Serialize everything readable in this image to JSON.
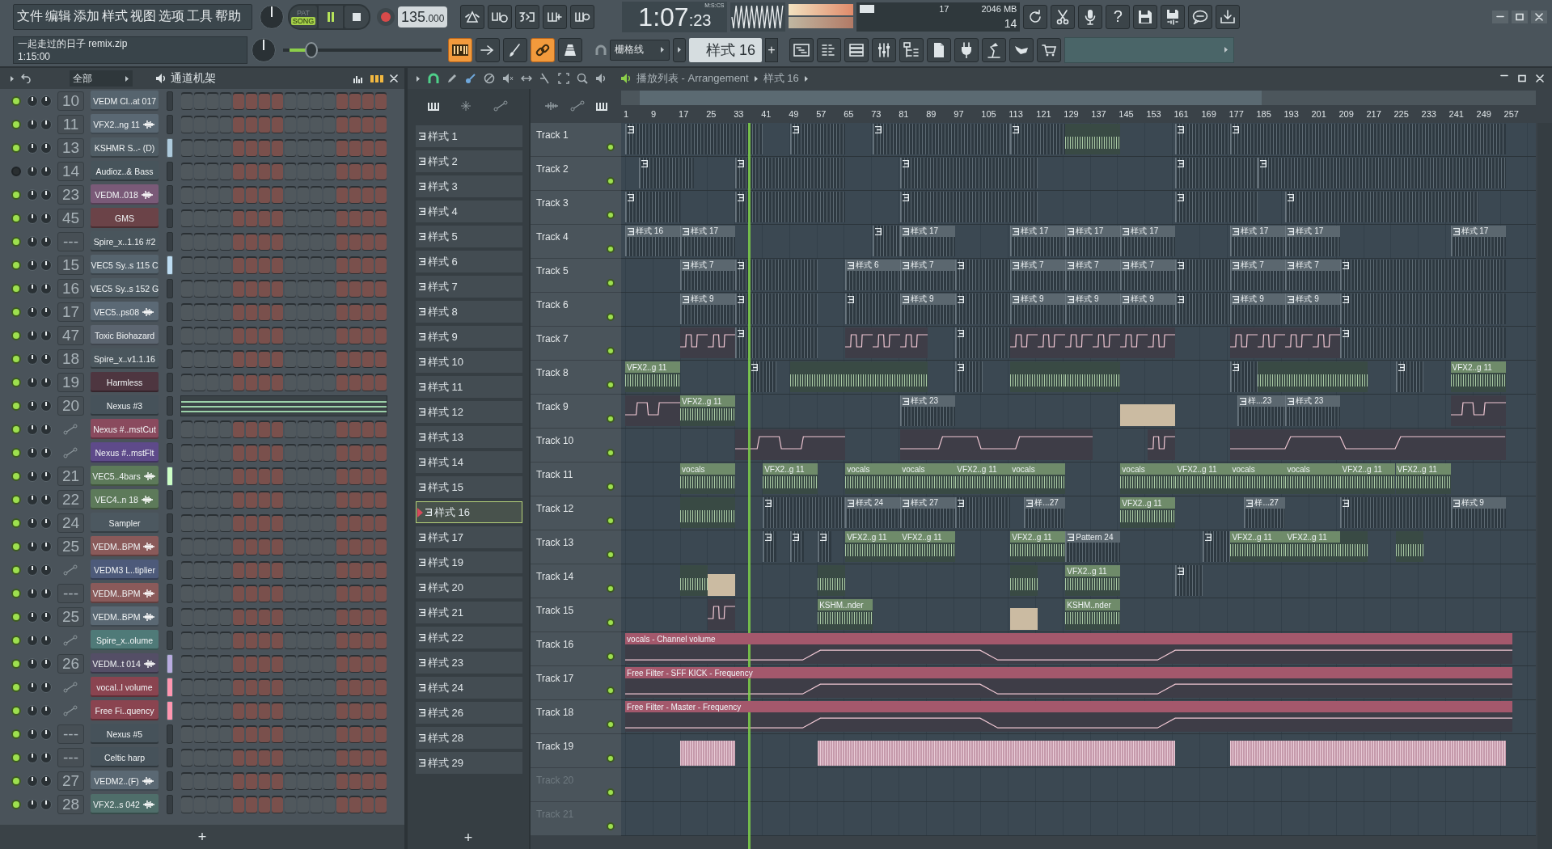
{
  "menu": [
    "文件",
    "编辑",
    "添加",
    "样式",
    "视图",
    "选项",
    "工具",
    "帮助"
  ],
  "transport": {
    "modes": [
      {
        "label": "PAT",
        "selected": false
      },
      {
        "label": "SONG",
        "selected": true
      }
    ],
    "playing": true,
    "recording": false,
    "tempo": "135",
    "tempo_fraction": ".000"
  },
  "clock": {
    "time": "1:07",
    "centiseconds": ":23",
    "format": "M:S:CS"
  },
  "monitor": {
    "cpu": "17",
    "memory": "2046 MB",
    "voices": "14"
  },
  "help": "?",
  "project": {
    "title": "一起走过的日子 remix.zip",
    "length": "1:15:00"
  },
  "master_volume": {
    "level": 0.15
  },
  "toggles": [
    {
      "on": true
    },
    {
      "on": false
    },
    {
      "on": false
    },
    {
      "on": true
    },
    {
      "on": false
    }
  ],
  "snap": {
    "value": "栅格线"
  },
  "pattern_selector": {
    "value": "样式 16",
    "add": "+"
  },
  "channel_rack": {
    "filter": "全部",
    "title": "通道机架",
    "add": "+",
    "channels": [
      {
        "number": "10",
        "name": "VEDM Cl..at 017",
        "kind": "number",
        "color": "#56646e",
        "on": true,
        "sample": false,
        "selected": false,
        "notes": false
      },
      {
        "number": "11",
        "name": "VFX2..ng 11",
        "kind": "number",
        "color": "#5a6873",
        "on": true,
        "sample": true,
        "selected": false,
        "notes": false
      },
      {
        "number": "13",
        "name": "KSHMR S..- (D)",
        "kind": "number",
        "color": "#4f5c64",
        "on": true,
        "sample": false,
        "selected": true,
        "notes": false
      },
      {
        "number": "14",
        "name": "Audioz..& Bass",
        "kind": "number",
        "color": "#47545b",
        "on": false,
        "sample": false,
        "selected": false,
        "notes": false
      },
      {
        "number": "23",
        "name": "VEDM..018",
        "kind": "number",
        "color": "#7a5a78",
        "on": true,
        "sample": true,
        "selected": false,
        "notes": false
      },
      {
        "number": "45",
        "name": "GMS",
        "kind": "number",
        "color": "#6b4348",
        "on": true,
        "sample": false,
        "selected": false,
        "notes": false
      },
      {
        "number": "---",
        "name": "Spire_x..1.16 #2",
        "kind": "number",
        "color": "#49555c",
        "on": true,
        "sample": false,
        "selected": false,
        "notes": false
      },
      {
        "number": "15",
        "name": "VEC5 Sy..s 115 C",
        "kind": "number",
        "color": "#56646e",
        "on": true,
        "sample": false,
        "selected": true,
        "notes": false
      },
      {
        "number": "16",
        "name": "VEC5 Sy..s 152 G",
        "kind": "number",
        "color": "#4f5c64",
        "on": true,
        "sample": false,
        "selected": false,
        "notes": false
      },
      {
        "number": "17",
        "name": "VEC5..ps08",
        "kind": "number",
        "color": "#5b6975",
        "on": true,
        "sample": true,
        "selected": false,
        "notes": false
      },
      {
        "number": "47",
        "name": "Toxic Biohazard",
        "kind": "number",
        "color": "#5c6570",
        "on": true,
        "sample": false,
        "selected": false,
        "notes": false
      },
      {
        "number": "18",
        "name": "Spire_x..v1.1.16",
        "kind": "number",
        "color": "#4a565d",
        "on": true,
        "sample": false,
        "selected": false,
        "notes": false
      },
      {
        "number": "19",
        "name": "Harmless",
        "kind": "number",
        "color": "#4e3640",
        "on": true,
        "sample": false,
        "selected": false,
        "notes": false
      },
      {
        "number": "20",
        "name": "Nexus #3",
        "kind": "number",
        "color": "#46525a",
        "on": true,
        "sample": false,
        "selected": false,
        "notes": true
      },
      {
        "name": "Nexus #..mstCut",
        "kind": "automation",
        "color": "#8a4a5e",
        "on": true,
        "sample": false,
        "selected": false,
        "notes": false
      },
      {
        "name": "Nexus #..mstFlt",
        "kind": "automation",
        "color": "#5e4a8a",
        "on": true,
        "sample": false,
        "selected": false,
        "notes": false
      },
      {
        "number": "21",
        "name": "VEC5..4bars",
        "kind": "number",
        "color": "#5d7a5a",
        "on": true,
        "sample": true,
        "selected": true,
        "notes": false
      },
      {
        "number": "22",
        "name": "VEC4..n 18",
        "kind": "number",
        "color": "#5d7a5a",
        "on": true,
        "sample": true,
        "selected": false,
        "notes": false
      },
      {
        "number": "24",
        "name": "Sampler",
        "kind": "number",
        "color": "#4c5860",
        "on": true,
        "sample": false,
        "selected": false,
        "notes": false
      },
      {
        "number": "25",
        "name": "VEDM..BPM",
        "kind": "number",
        "color": "#8a5a5a",
        "on": true,
        "sample": true,
        "selected": false,
        "notes": false
      },
      {
        "name": "VEDM3 L..tiplier",
        "kind": "automation",
        "color": "#4d5a7a",
        "on": true,
        "sample": false,
        "selected": false,
        "notes": false
      },
      {
        "number": "---",
        "name": "VEDM..BPM",
        "kind": "number",
        "color": "#8a5a5a",
        "on": true,
        "sample": true,
        "selected": false,
        "notes": false
      },
      {
        "number": "25",
        "name": "VEDM..BPM",
        "kind": "number",
        "color": "#5a6873",
        "on": true,
        "sample": true,
        "selected": false,
        "notes": false
      },
      {
        "name": "Spire_x..olume",
        "kind": "automation",
        "color": "#4f7a78",
        "on": true,
        "sample": false,
        "selected": false,
        "notes": false
      },
      {
        "number": "26",
        "name": "VEDM..t 014",
        "kind": "number",
        "color": "#544e66",
        "on": true,
        "sample": true,
        "selected": true,
        "notes": false
      },
      {
        "name": "vocal..l volume",
        "kind": "automation",
        "color": "#8a4450",
        "on": true,
        "sample": false,
        "selected": true,
        "notes": false
      },
      {
        "name": "Free Fi..quency",
        "kind": "automation",
        "color": "#8a4450",
        "on": true,
        "sample": false,
        "selected": true,
        "notes": false
      },
      {
        "number": "---",
        "name": "Nexus #5",
        "kind": "number",
        "color": "#46525a",
        "on": true,
        "sample": false,
        "selected": false,
        "notes": false
      },
      {
        "number": "---",
        "name": "Celtic harp",
        "kind": "number",
        "color": "#46525a",
        "on": true,
        "sample": false,
        "selected": false,
        "notes": false
      },
      {
        "number": "27",
        "name": "VEDM2..(F)",
        "kind": "number",
        "color": "#5a6873",
        "on": true,
        "sample": true,
        "selected": false,
        "notes": false
      },
      {
        "number": "28",
        "name": "VFX2..s 042",
        "kind": "number",
        "color": "#4f6e6a",
        "on": true,
        "sample": true,
        "selected": false,
        "notes": false
      }
    ]
  },
  "playlist": {
    "title": "播放列表 - Arrangement",
    "current_pattern": "样式 16",
    "add_pattern": "+",
    "patterns": [
      {
        "name": "样式 1",
        "selected": false
      },
      {
        "name": "样式 2",
        "selected": false
      },
      {
        "name": "样式 3",
        "selected": false
      },
      {
        "name": "样式 4",
        "selected": false
      },
      {
        "name": "样式 5",
        "selected": false
      },
      {
        "name": "样式 6",
        "selected": false
      },
      {
        "name": "样式 7",
        "selected": false
      },
      {
        "name": "样式 8",
        "selected": false
      },
      {
        "name": "样式 9",
        "selected": false
      },
      {
        "name": "样式 10",
        "selected": false
      },
      {
        "name": "样式 11",
        "selected": false
      },
      {
        "name": "样式 12",
        "selected": false
      },
      {
        "name": "样式 13",
        "selected": false
      },
      {
        "name": "样式 14",
        "selected": false
      },
      {
        "name": "样式 15",
        "selected": false
      },
      {
        "name": "样式 16",
        "selected": true
      },
      {
        "name": "样式 17",
        "selected": false
      },
      {
        "name": "样式 19",
        "selected": false
      },
      {
        "name": "样式 20",
        "selected": false
      },
      {
        "name": "样式 21",
        "selected": false
      },
      {
        "name": "样式 22",
        "selected": false
      },
      {
        "name": "样式 23",
        "selected": false
      },
      {
        "name": "样式 24",
        "selected": false
      },
      {
        "name": "样式 26",
        "selected": false
      },
      {
        "name": "样式 28",
        "selected": false
      },
      {
        "name": "样式 29",
        "selected": false
      }
    ],
    "ruler": [
      "1",
      "9",
      "17",
      "25",
      "33",
      "41",
      "49",
      "57",
      "65",
      "73",
      "81",
      "89",
      "97",
      "105",
      "113",
      "121",
      "129",
      "137",
      "145",
      "153",
      "161",
      "169",
      "177",
      "185",
      "193",
      "201",
      "209",
      "217",
      "225",
      "233",
      "241",
      "249",
      "257"
    ],
    "playhead": {
      "level": 0.139
    },
    "tracks": [
      {
        "name": "Track 1",
        "empty": false,
        "clips": [
          {
            "kind": "pattern"
          },
          {
            "kind": "pattern"
          },
          {
            "kind": "pattern"
          },
          {
            "kind": "pattern"
          },
          {
            "kind": "audio"
          },
          {
            "kind": "pattern"
          },
          {
            "kind": "pattern"
          }
        ]
      },
      {
        "name": "Track 2",
        "empty": false,
        "clips": [
          {
            "kind": "pattern"
          },
          {
            "kind": "pattern"
          },
          {
            "kind": "pattern"
          },
          {
            "kind": "pattern"
          },
          {
            "kind": "pattern"
          }
        ]
      },
      {
        "name": "Track 3",
        "empty": false,
        "clips": [
          {
            "kind": "pattern"
          },
          {
            "kind": "pattern"
          },
          {
            "kind": "pattern"
          },
          {
            "kind": "pattern"
          },
          {
            "kind": "pattern"
          }
        ]
      },
      {
        "name": "Track 4",
        "empty": false,
        "clips": [
          {
            "kind": "pattern",
            "label": "样式 16"
          },
          {
            "kind": "pattern",
            "label": "样式 17"
          },
          {
            "kind": "pattern"
          },
          {
            "kind": "pattern",
            "label": "样式 17"
          },
          {
            "kind": "pattern",
            "label": "样式 17"
          },
          {
            "kind": "pattern",
            "label": "样式 17"
          },
          {
            "kind": "pattern",
            "label": "样式 17"
          },
          {
            "kind": "pattern",
            "label": "样式 17"
          },
          {
            "kind": "pattern",
            "label": "样式 17"
          },
          {
            "kind": "pattern",
            "label": "样式 17"
          }
        ]
      },
      {
        "name": "Track 5",
        "empty": false,
        "clips": [
          {
            "kind": "pattern",
            "label": "样式 7"
          },
          {
            "kind": "pattern"
          },
          {
            "kind": "pattern",
            "label": "样式 6"
          },
          {
            "kind": "pattern",
            "label": "样式 7"
          },
          {
            "kind": "pattern"
          },
          {
            "kind": "pattern",
            "label": "样式 7"
          },
          {
            "kind": "pattern",
            "label": "样式 7"
          },
          {
            "kind": "pattern",
            "label": "样式 7"
          },
          {
            "kind": "pattern"
          },
          {
            "kind": "pattern",
            "label": "样式 7"
          },
          {
            "kind": "pattern",
            "label": "样式 7"
          },
          {
            "kind": "pattern"
          }
        ]
      },
      {
        "name": "Track 6",
        "empty": false,
        "clips": [
          {
            "kind": "pattern",
            "label": "样式 9"
          },
          {
            "kind": "pattern"
          },
          {
            "kind": "pattern"
          },
          {
            "kind": "pattern",
            "label": "样式 9"
          },
          {
            "kind": "pattern"
          },
          {
            "kind": "pattern",
            "label": "样式 9"
          },
          {
            "kind": "pattern",
            "label": "样式 9"
          },
          {
            "kind": "pattern",
            "label": "样式 9"
          },
          {
            "kind": "pattern"
          },
          {
            "kind": "pattern",
            "label": "样式 9"
          },
          {
            "kind": "pattern",
            "label": "样式 9"
          },
          {
            "kind": "pattern"
          }
        ]
      },
      {
        "name": "Track 7",
        "empty": false,
        "clips": [
          {
            "kind": "automation"
          },
          {
            "kind": "automation"
          },
          {
            "kind": "pattern"
          },
          {
            "kind": "automation"
          },
          {
            "kind": "automation"
          },
          {
            "kind": "automation"
          },
          {
            "kind": "pattern"
          },
          {
            "kind": "automation"
          },
          {
            "kind": "automation"
          },
          {
            "kind": "automation"
          },
          {
            "kind": "automation"
          },
          {
            "kind": "automation"
          },
          {
            "kind": "automation"
          },
          {
            "kind": "automation"
          },
          {
            "kind": "automation"
          },
          {
            "kind": "automation"
          },
          {
            "kind": "automation"
          },
          {
            "kind": "pattern"
          }
        ]
      },
      {
        "name": "Track 8",
        "empty": false,
        "clips": [
          {
            "kind": "audio",
            "label": "VFX2..g 11"
          },
          {
            "kind": "pattern"
          },
          {
            "kind": "audio"
          },
          {
            "kind": "pattern"
          },
          {
            "kind": "audio"
          },
          {
            "kind": "audio"
          },
          {
            "kind": "pattern"
          },
          {
            "kind": "audio"
          },
          {
            "kind": "pattern"
          },
          {
            "kind": "audio",
            "label": "VFX2..g 11"
          }
        ]
      },
      {
        "name": "Track 9",
        "empty": false,
        "clips": [
          {
            "kind": "automation"
          },
          {
            "kind": "audio",
            "label": "VFX2..g 11"
          },
          {
            "kind": "pattern",
            "label": "样式 23"
          },
          {
            "kind": "tan"
          },
          {
            "kind": "pattern",
            "label": "样...23"
          },
          {
            "kind": "pattern",
            "label": "样式 23"
          },
          {
            "kind": "automation"
          }
        ]
      },
      {
        "name": "Track 10",
        "empty": false,
        "clips": [
          {
            "kind": "automation"
          },
          {
            "kind": "automation"
          },
          {
            "kind": "automation"
          },
          {
            "kind": "automation"
          }
        ]
      },
      {
        "name": "Track 11",
        "empty": false,
        "clips": [
          {
            "kind": "audio",
            "label": "vocals"
          },
          {
            "kind": "audio",
            "label": "VFX2..g 11"
          },
          {
            "kind": "audio",
            "label": "vocals"
          },
          {
            "kind": "audio",
            "label": "vocals"
          },
          {
            "kind": "audio",
            "label": "VFX2..g 11"
          },
          {
            "kind": "audio",
            "label": "vocals"
          },
          {
            "kind": "audio",
            "label": "vocals"
          },
          {
            "kind": "audio",
            "label": "VFX2..g 11"
          },
          {
            "kind": "audio",
            "label": "vocals"
          },
          {
            "kind": "audio",
            "label": "vocals"
          },
          {
            "kind": "audio",
            "label": "VFX2..g 11"
          },
          {
            "kind": "audio",
            "label": "VFX2..g 11"
          }
        ]
      },
      {
        "name": "Track 12",
        "empty": false,
        "clips": [
          {
            "kind": "audio"
          },
          {
            "kind": "pattern"
          },
          {
            "kind": "pattern",
            "label": "样式 24"
          },
          {
            "kind": "pattern",
            "label": "样式 27"
          },
          {
            "kind": "pattern"
          },
          {
            "kind": "pattern",
            "label": "样...27"
          },
          {
            "kind": "audio",
            "label": "VFX2..g 11"
          },
          {
            "kind": "pattern",
            "label": "样...27"
          },
          {
            "kind": "pattern"
          },
          {
            "kind": "pattern",
            "label": "样式 9"
          }
        ]
      },
      {
        "name": "Track 13",
        "empty": false,
        "clips": [
          {
            "kind": "pattern"
          },
          {
            "kind": "pattern"
          },
          {
            "kind": "pattern"
          },
          {
            "kind": "audio",
            "label": "VFX2..g 11"
          },
          {
            "kind": "audio",
            "label": "VFX2..g 11"
          },
          {
            "kind": "audio",
            "label": "VFX2..g 11"
          },
          {
            "kind": "pattern",
            "label": "Pattern 24"
          },
          {
            "kind": "pattern"
          },
          {
            "kind": "audio",
            "label": "VFX2..g 11"
          },
          {
            "kind": "audio",
            "label": "VFX2..g 11"
          },
          {
            "kind": "audio"
          },
          {
            "kind": "audio"
          }
        ]
      },
      {
        "name": "Track 14",
        "empty": false,
        "clips": [
          {
            "kind": "audio"
          },
          {
            "kind": "tan"
          },
          {
            "kind": "audio"
          },
          {
            "kind": "audio"
          },
          {
            "kind": "audio",
            "label": "VFX2..g 11"
          },
          {
            "kind": "pattern"
          }
        ]
      },
      {
        "name": "Track 15",
        "empty": false,
        "clips": [
          {
            "kind": "automation"
          },
          {
            "kind": "audio",
            "label": "KSHM..nder"
          },
          {
            "kind": "tan"
          },
          {
            "kind": "audio",
            "label": "KSHM..nder"
          }
        ]
      },
      {
        "name": "Track 16",
        "empty": false,
        "clips": [
          {
            "kind": "automation",
            "label": "vocals - Channel volume"
          }
        ]
      },
      {
        "name": "Track 17",
        "empty": false,
        "clips": [
          {
            "kind": "automation",
            "label": "Free Filter - SFF KICK - Frequency"
          }
        ]
      },
      {
        "name": "Track 18",
        "empty": false,
        "clips": [
          {
            "kind": "automation",
            "label": "Free Filter - Master - Frequency"
          }
        ]
      },
      {
        "name": "Track 19",
        "empty": false,
        "clips": [
          {
            "kind": "vocal"
          },
          {
            "kind": "vocal"
          },
          {
            "kind": "vocal"
          },
          {
            "kind": "vocal"
          }
        ]
      },
      {
        "name": "Track 20",
        "empty": true
      },
      {
        "name": "Track 21",
        "empty": true
      }
    ]
  }
}
